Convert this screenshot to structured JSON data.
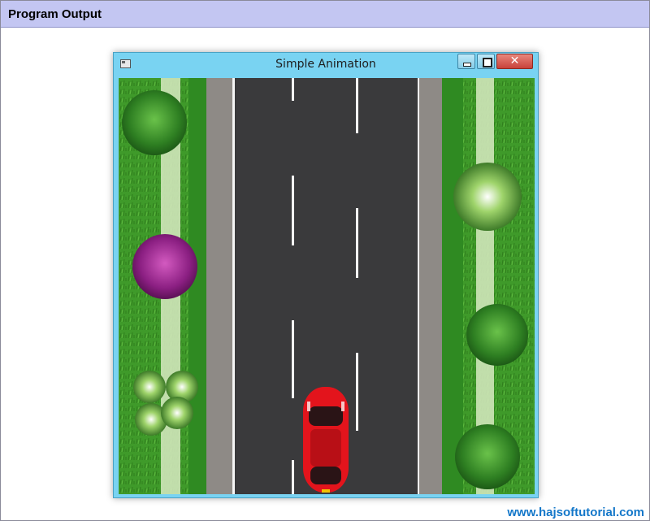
{
  "header": {
    "title": "Program Output"
  },
  "window": {
    "title": "Simple Animation",
    "close_glyph": "✕"
  },
  "footer": {
    "link": "www.hajsoftutorial.com"
  },
  "icons": {
    "app": "app-window-icon",
    "minimize": "minimize-icon",
    "maximize": "maximize-icon",
    "close": "close-icon"
  },
  "colors": {
    "header_bg": "#c3c6f2",
    "titlebar": "#79d3f2",
    "road": "#3a3a3c",
    "grass": "#3f9a2a",
    "car": "#e3141c",
    "link": "#1377c9"
  }
}
